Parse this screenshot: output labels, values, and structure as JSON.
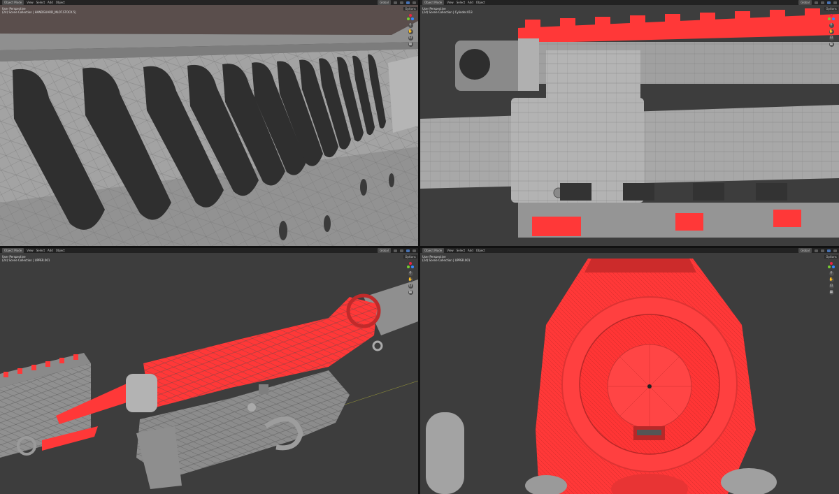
{
  "colors": {
    "viewport_bg": "#3d3d3d",
    "mesh_gray": "#9a9a9a",
    "selection_red": "#ff3838",
    "header_bg": "#202020",
    "active_blue": "#4772b3"
  },
  "viewports": [
    {
      "mode": "Object Mode",
      "menus": [
        "View",
        "Select",
        "Add",
        "Object"
      ],
      "orientation": "Global",
      "options_label": "Options",
      "overlay_line1": "User Perspective",
      "overlay_line2": "(24) Scene Collection | HANDGUARD_MLOT.STOCK.5|",
      "nav_icons": [
        "zoom-icon",
        "hand-icon",
        "camera-icon",
        "grid-icon"
      ]
    },
    {
      "mode": "Object Mode",
      "menus": [
        "View",
        "Select",
        "Add",
        "Object"
      ],
      "orientation": "Global",
      "options_label": "Options",
      "overlay_line1": "User Perspective",
      "overlay_line2": "(24) Scene Collection | Cylinder.013",
      "nav_icons": [
        "zoom-icon",
        "hand-icon",
        "camera-icon",
        "grid-icon"
      ]
    },
    {
      "mode": "Object Mode",
      "menus": [
        "View",
        "Select",
        "Add",
        "Object"
      ],
      "orientation": "Global",
      "options_label": "Options",
      "overlay_line1": "User Perspective",
      "overlay_line2": "(24) Scene Collection | UPPER.001",
      "nav_icons": [
        "zoom-icon",
        "hand-icon",
        "camera-icon",
        "grid-icon"
      ]
    },
    {
      "mode": "Object Mode",
      "menus": [
        "View",
        "Select",
        "Add",
        "Object"
      ],
      "orientation": "Global",
      "options_label": "Options",
      "overlay_line1": "User Perspective",
      "overlay_line2": "(24) Scene Collection | UPPER.001",
      "nav_icons": [
        "zoom-icon",
        "hand-icon",
        "camera-icon",
        "grid-icon"
      ]
    }
  ]
}
